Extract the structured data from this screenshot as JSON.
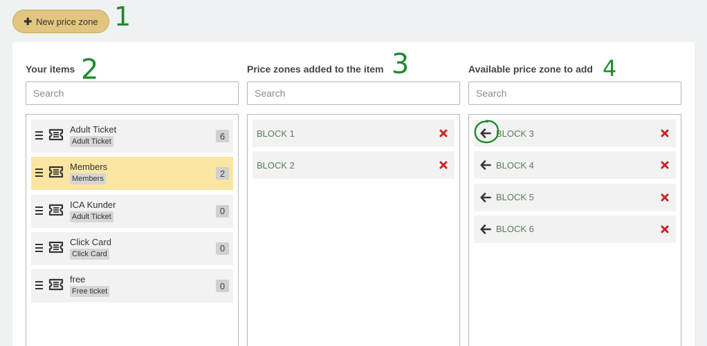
{
  "toolbar": {
    "new_zone_label": "New price zone"
  },
  "annotations": [
    "1",
    "2",
    "3",
    "4"
  ],
  "columns": {
    "items": {
      "title": "Your items",
      "search_placeholder": "Search",
      "list": [
        {
          "name": "Adult Ticket",
          "tag": "Adult Ticket",
          "count": "6",
          "selected": false
        },
        {
          "name": "Members",
          "tag": "Members",
          "count": "2",
          "selected": true
        },
        {
          "name": "ICA Kunder",
          "tag": "Adult Ticket",
          "count": "0",
          "selected": false
        },
        {
          "name": "Click Card",
          "tag": "Click Card",
          "count": "0",
          "selected": false
        },
        {
          "name": "free",
          "tag": "Free ticket",
          "count": "0",
          "selected": false
        }
      ]
    },
    "added": {
      "title": "Price zones added to the item",
      "search_placeholder": "Search",
      "list": [
        {
          "label": "BLOCK 1"
        },
        {
          "label": "BLOCK 2"
        }
      ]
    },
    "available": {
      "title": "Available price zone to add",
      "search_placeholder": "Search",
      "list": [
        {
          "label": "BLOCK 3"
        },
        {
          "label": "BLOCK 4"
        },
        {
          "label": "BLOCK 5"
        },
        {
          "label": "BLOCK 6"
        }
      ]
    }
  },
  "colors": {
    "button_bg": "#e2c57f",
    "selected_row": "#fae5a3",
    "remove_red": "#d0201c",
    "zone_text": "#5b7a5b",
    "annotation_green": "#1f8a2e"
  }
}
